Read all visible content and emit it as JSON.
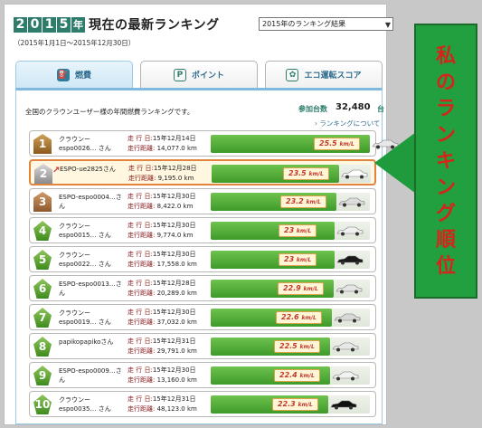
{
  "header": {
    "year_digits": [
      "2",
      "0",
      "1",
      "5"
    ],
    "year_suffix": "年",
    "title": "現在の最新ランキング",
    "period": "（2015年1月1日～2015年12月30日）",
    "period_select": "2015年のランキング結果"
  },
  "tabs": [
    {
      "label": "燃費",
      "icon": "fuel-icon",
      "active": true
    },
    {
      "label": "ポイント",
      "icon": "points-icon",
      "active": false
    },
    {
      "label": "エコ運転スコア",
      "icon": "eco-score-icon",
      "active": false
    }
  ],
  "summary": {
    "intro": "全国のクラウンユーザー様の年間燃費ランキングです。",
    "participants_label": "参加台数",
    "participants_value": "32,480",
    "participants_unit": "台",
    "about_link": "› ランキングについて"
  },
  "labels": {
    "drive_date": "走 行 日:",
    "drive_distance": "走行距離:",
    "unit_km_l": "km/L"
  },
  "rows": [
    {
      "rank": "1",
      "badge": "gold",
      "mine": false,
      "up": false,
      "name": "クラウンーespo0026… さん",
      "date": "15年12月14日",
      "distance": "14,077.0 km",
      "fuel": "25.5",
      "fill": 1.0,
      "car_color": "#e8e8e8"
    },
    {
      "rank": "2",
      "badge": "silver",
      "mine": true,
      "up": true,
      "name": "ESPO-ue2825さん",
      "date": "15年12月28日",
      "distance": "9,195.0 km",
      "fuel": "23.5",
      "fill": 0.8,
      "car_color": "#ffffff"
    },
    {
      "rank": "3",
      "badge": "bronze",
      "mine": false,
      "up": false,
      "name": "ESPO-espo0004…さん",
      "date": "15年12月30日",
      "distance": "8,422.0 km",
      "fuel": "23.2",
      "fill": 0.79,
      "car_color": "#dcdcdc"
    },
    {
      "rank": "4",
      "badge": "green",
      "mine": false,
      "up": false,
      "name": "クラウンーespo0015… さん",
      "date": "15年12月30日",
      "distance": "9,774.0 km",
      "fuel": "23",
      "fill": 0.78,
      "car_color": "#f0f0f0"
    },
    {
      "rank": "5",
      "badge": "green",
      "mine": false,
      "up": false,
      "name": "クラウンーespo0022… さん",
      "date": "15年12月30日",
      "distance": "17,558.0 km",
      "fuel": "23",
      "fill": 0.78,
      "car_color": "#1a1a1a"
    },
    {
      "rank": "6",
      "badge": "green",
      "mine": false,
      "up": false,
      "name": "ESPO-espo0013…さん",
      "date": "15年12月28日",
      "distance": "20,289.0 km",
      "fuel": "22.9",
      "fill": 0.77,
      "car_color": "#e4e4e4"
    },
    {
      "rank": "7",
      "badge": "green",
      "mine": false,
      "up": false,
      "name": "クラウンーespo0019… さん",
      "date": "15年12月30日",
      "distance": "37,032.0 km",
      "fuel": "22.6",
      "fill": 0.76,
      "car_color": "#d8d8d8"
    },
    {
      "rank": "8",
      "badge": "green",
      "mine": false,
      "up": false,
      "name": "papikopapikoさん",
      "date": "15年12月31日",
      "distance": "29,791.0 km",
      "fuel": "22.5",
      "fill": 0.75,
      "car_color": "#e8e8e8"
    },
    {
      "rank": "9",
      "badge": "green",
      "mine": false,
      "up": false,
      "name": "ESPO-espo0009…さん",
      "date": "15年12月30日",
      "distance": "13,160.0 km",
      "fuel": "22.4",
      "fill": 0.75,
      "car_color": "#f2f2f2"
    },
    {
      "rank": "10",
      "badge": "green",
      "mine": false,
      "up": false,
      "name": "クラウンーespo0035… さん",
      "date": "15年12月31日",
      "distance": "48,123.0 km",
      "fuel": "22.3",
      "fill": 0.74,
      "car_color": "#111111"
    }
  ],
  "callout": {
    "text_chars": [
      "私",
      "の",
      "ラ",
      "ン",
      "キ",
      "ン",
      "グ",
      "順",
      "位"
    ],
    "bg_color": "#22a040",
    "text_color": "#d4251a"
  }
}
